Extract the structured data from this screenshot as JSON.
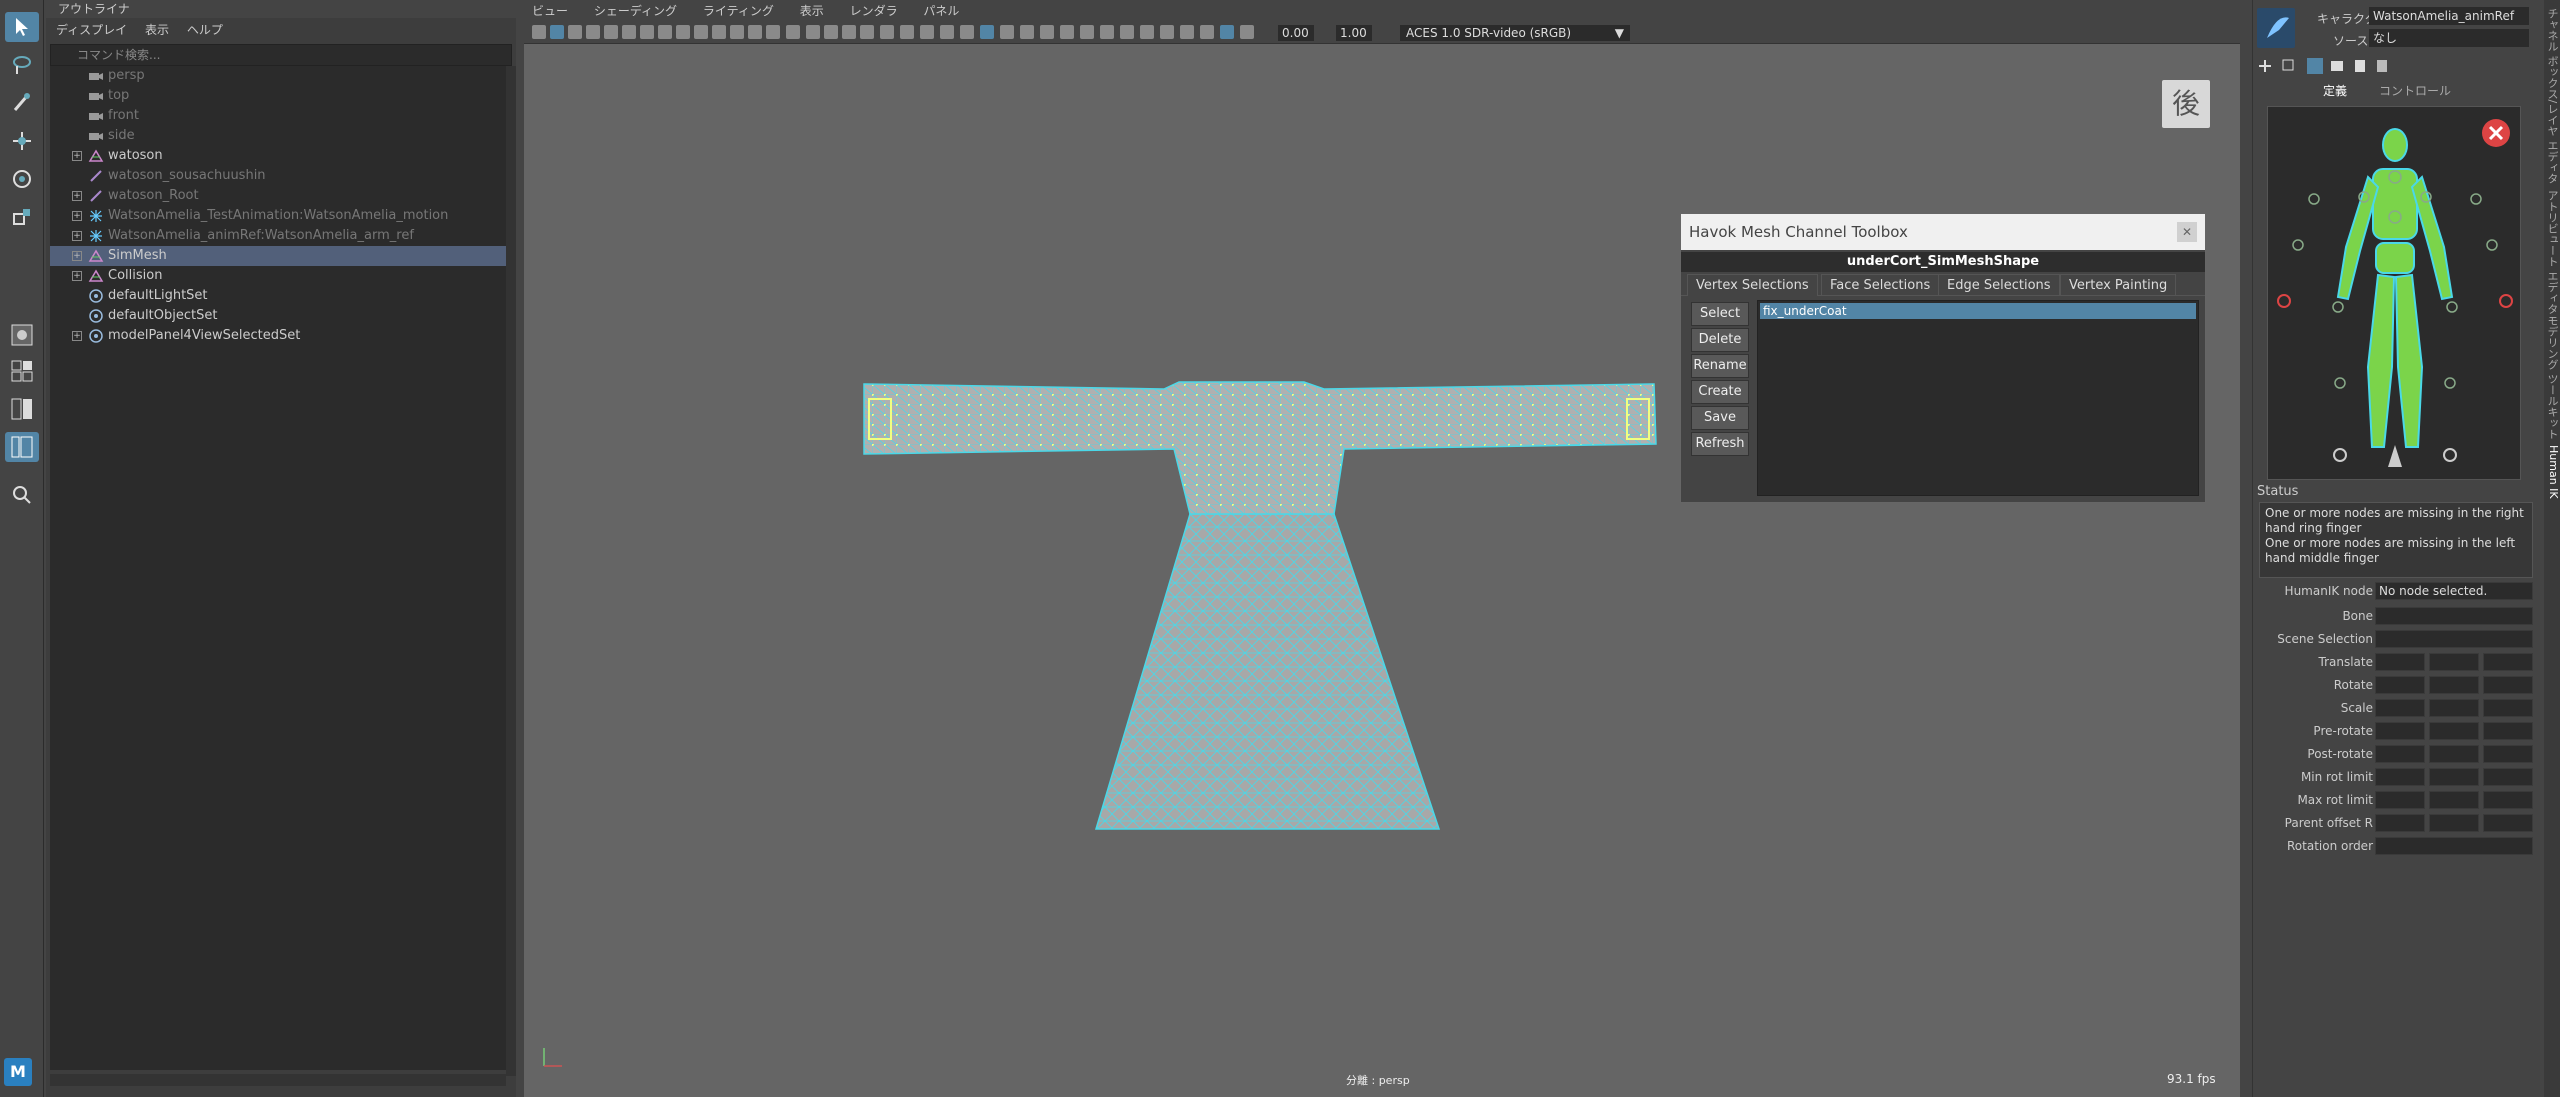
{
  "outliner": {
    "title": "アウトライナ",
    "menu": [
      "ディスプレイ",
      "表示",
      "ヘルプ"
    ],
    "search_placeholder": "コマンド検索...",
    "items": [
      {
        "label": "persp",
        "dim": true,
        "icon": "camera-icon",
        "expand": false
      },
      {
        "label": "top",
        "dim": true,
        "icon": "camera-icon",
        "expand": false
      },
      {
        "label": "front",
        "dim": true,
        "icon": "camera-icon",
        "expand": false
      },
      {
        "label": "side",
        "dim": true,
        "icon": "camera-icon",
        "expand": false
      },
      {
        "label": "watoson",
        "dim": false,
        "icon": "transform-icon",
        "expand": true
      },
      {
        "label": "watoson_sousachuushin",
        "dim": true,
        "icon": "joint-icon",
        "expand": false
      },
      {
        "label": "watoson_Root",
        "dim": true,
        "icon": "joint-icon",
        "expand": true
      },
      {
        "label": "WatsonAmelia_TestAnimation:WatsonAmelia_motion",
        "dim": true,
        "icon": "locator-icon",
        "expand": true
      },
      {
        "label": "WatsonAmelia_animRef:WatsonAmelia_arm_ref",
        "dim": true,
        "icon": "locator-icon",
        "expand": true
      },
      {
        "label": "SimMesh",
        "dim": false,
        "icon": "transform-icon",
        "expand": true,
        "selected": true
      },
      {
        "label": "Collision",
        "dim": false,
        "icon": "transform-icon",
        "expand": true
      },
      {
        "label": "defaultLightSet",
        "dim": false,
        "icon": "set-icon",
        "expand": false
      },
      {
        "label": "defaultObjectSet",
        "dim": false,
        "icon": "set-icon",
        "expand": false
      },
      {
        "label": "modelPanel4ViewSelectedSet",
        "dim": false,
        "icon": "set-icon",
        "expand": true
      }
    ]
  },
  "viewport": {
    "menu": [
      "ビュー",
      "シェーディング",
      "ライティング",
      "表示",
      "レンダラ",
      "パネル"
    ],
    "exposure": "0.00",
    "gamma": "1.00",
    "colorspace": "ACES 1.0 SDR-video (sRGB)",
    "view_cube_label": "後",
    "camera_label": "分離 : persp",
    "fps": "93.1 fps"
  },
  "havok": {
    "title": "Havok Mesh Channel Toolbox",
    "shape": "underCort_SimMeshShape",
    "tabs": [
      "Vertex Selections",
      "Face Selections",
      "Edge Selections",
      "Vertex Painting"
    ],
    "buttons": [
      "Select",
      "Delete",
      "Rename",
      "Create",
      "Save",
      "Refresh"
    ],
    "selections": [
      "fix_underCoat"
    ]
  },
  "hik": {
    "character_label": "キャラクタ:",
    "character_value": "WatsonAmelia_animRef",
    "source_label": "ソース:",
    "source_value": "なし",
    "tabs": [
      "定義",
      "コントロール"
    ],
    "status_label": "Status",
    "status_lines": [
      "One or more nodes are missing in the right hand ring finger",
      "One or more nodes are missing in the left hand middle finger"
    ],
    "props": {
      "humanik_node_label": "HumanIK node",
      "humanik_node_value": "No node selected.",
      "rows": [
        "Bone",
        "Scene Selection",
        "Translate",
        "Rotate",
        "Scale",
        "Pre-rotate",
        "Post-rotate",
        "Min rot limit",
        "Max rot limit",
        "Parent offset R",
        "Rotation order"
      ]
    }
  },
  "side_tabs": [
    "チャネル ボックス/レイヤ エディタ",
    "アトリビュート エディタ",
    "モデリング ツールキット",
    "Human IK"
  ],
  "colors": {
    "accent": "#5285a6",
    "mesh_wire": "#4ad8e8",
    "vertex": "#f0ff80",
    "figure_body": "#7bd44a"
  }
}
